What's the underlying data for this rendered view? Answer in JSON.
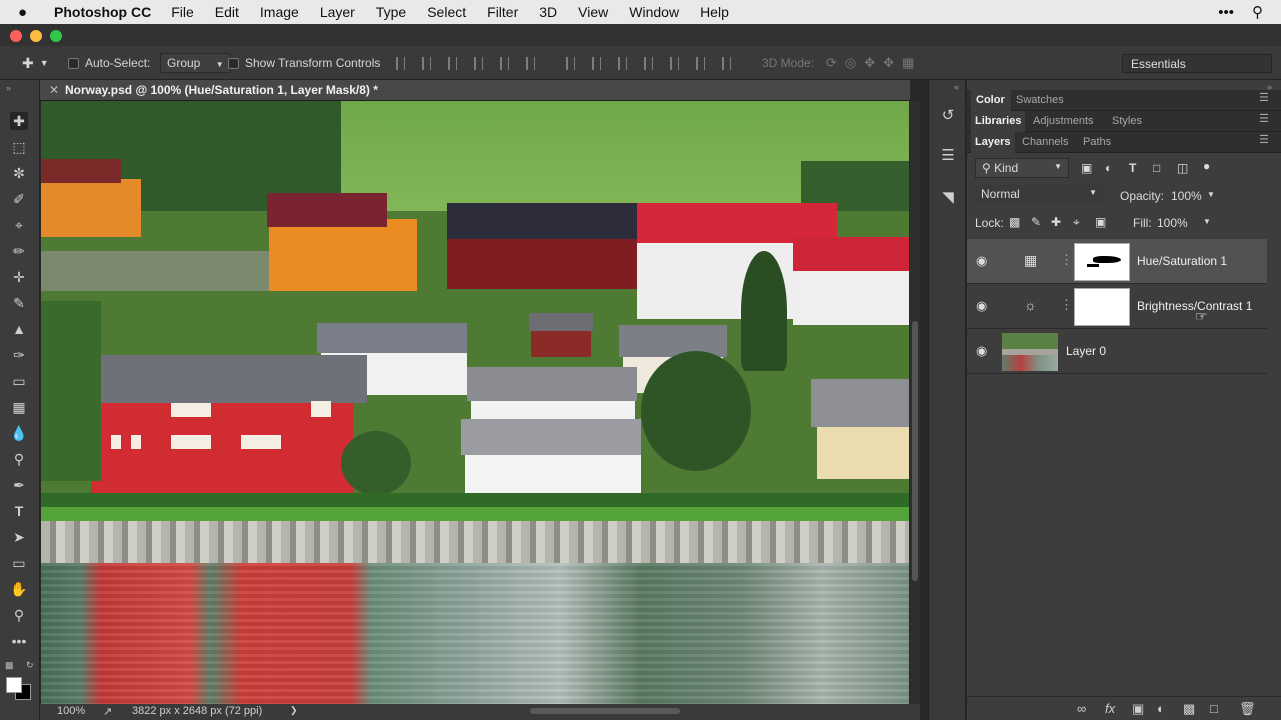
{
  "menubar": {
    "apple": "",
    "app_name": "Photoshop CC",
    "items": [
      "File",
      "Edit",
      "Image",
      "Layer",
      "Type",
      "Select",
      "Filter",
      "3D",
      "View",
      "Window",
      "Help"
    ],
    "right_icons": [
      "more-icon",
      "search-icon"
    ]
  },
  "window": {
    "traffic_lights": [
      "#fc605c",
      "#fdbc40",
      "#34c84a"
    ]
  },
  "options_bar": {
    "auto_select_label": "Auto-Select:",
    "auto_select_value": "Group",
    "show_transform_label": "Show Transform Controls",
    "mode_3d_label": "3D Mode:",
    "workspace": "Essentials"
  },
  "document": {
    "tab_title": "Norway.psd @ 100% (Hue/Saturation 1, Layer Mask/8) *",
    "zoom": "100%",
    "dimensions": "3822 px x 2648 px (72 ppi)"
  },
  "tools": [
    "move-tool",
    "marquee-tool",
    "lasso-tool",
    "quick-select-tool",
    "crop-tool",
    "eyedropper-tool",
    "healing-tool",
    "brush-tool",
    "stamp-tool",
    "history-brush-tool",
    "eraser-tool",
    "gradient-tool",
    "blur-tool",
    "dodge-tool",
    "pen-tool",
    "type-tool",
    "path-select-tool",
    "shape-tool",
    "hand-tool",
    "zoom-tool",
    "more-tools"
  ],
  "panels": {
    "row1_tabs": [
      "Color",
      "Swatches"
    ],
    "row2_tabs": [
      "Libraries",
      "Adjustments",
      "Styles"
    ],
    "row3_tabs": [
      "Layers",
      "Channels",
      "Paths"
    ],
    "filter_kind": "Kind",
    "blend_mode": "Normal",
    "opacity_label": "Opacity:",
    "opacity_value": "100%",
    "lock_label": "Lock:",
    "fill_label": "Fill:",
    "fill_value": "100%"
  },
  "layers": [
    {
      "name": "Hue/Saturation 1",
      "type": "adjustment",
      "icon": "hue-saturation-icon",
      "selected": true
    },
    {
      "name": "Brightness/Contrast 1",
      "type": "adjustment",
      "icon": "brightness-icon",
      "selected": false
    },
    {
      "name": "Layer 0",
      "type": "pixel",
      "selected": false
    }
  ],
  "colors": {
    "panel_bg": "#3d3d3d",
    "menubar_bg": "#e9e9e9",
    "selected_layer": "#525252"
  }
}
